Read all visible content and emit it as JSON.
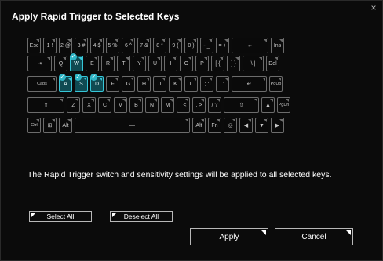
{
  "dialog": {
    "title": "Apply Rapid Trigger to Selected Keys",
    "close_label": "×",
    "description": "The Rapid Trigger switch and sensitivity settings will be applied to all selected keys.",
    "select_all": "Select All",
    "deselect_all": "Deselect All",
    "apply": "Apply",
    "cancel": "Cancel"
  },
  "colors": {
    "selected_key": "#0f4a52",
    "selected_border": "#36c6d8",
    "check_badge": "#2fb5c6",
    "key_border": "#6c6c6c"
  },
  "keyboard": {
    "row1": [
      "Esc",
      "1 !",
      "2 @",
      "3 #",
      "4 $",
      "5 %",
      "6 ^",
      "7 &",
      "8 *",
      "9 (",
      "0 )",
      "- _",
      "= +",
      "←",
      "Ins"
    ],
    "row2": [
      "⇥",
      "Q",
      "W",
      "E",
      "R",
      "T",
      "Y",
      "U",
      "I",
      "O",
      "P",
      "[ {",
      "] }",
      "\\ |",
      "Del"
    ],
    "row3": [
      "Caps",
      "A",
      "S",
      "D",
      "F",
      "G",
      "H",
      "J",
      "K",
      "L",
      "; :",
      "' \"",
      "↵",
      "PgUp"
    ],
    "row4": [
      "⇧",
      "Z",
      "X",
      "C",
      "V",
      "B",
      "N",
      "M",
      ", <",
      ". >",
      "/ ?",
      "⇧",
      "▲",
      "PgDn"
    ],
    "row5": [
      "Ctrl",
      "⊞",
      "Alt",
      "—",
      "Alt",
      "Fn",
      "◎",
      "◀",
      "▼",
      "▶"
    ],
    "selected_keys": [
      "W",
      "A",
      "S",
      "D"
    ]
  }
}
